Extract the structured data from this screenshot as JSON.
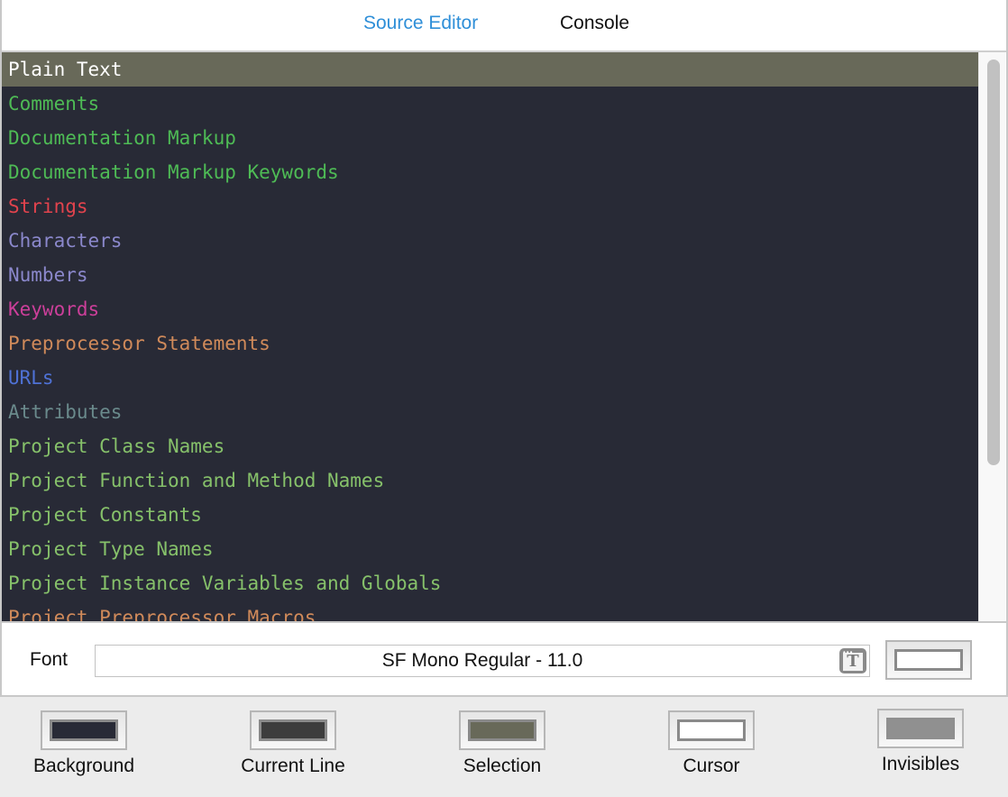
{
  "tabs": [
    {
      "label": "Source Editor",
      "active": true
    },
    {
      "label": "Console",
      "active": false
    }
  ],
  "syntax_items": [
    {
      "label": "Plain Text",
      "color": "#ffffff",
      "selected": true
    },
    {
      "label": "Comments",
      "color": "#4ebb55"
    },
    {
      "label": "Documentation Markup",
      "color": "#4ebb55"
    },
    {
      "label": "Documentation Markup Keywords",
      "color": "#4ebb55"
    },
    {
      "label": "Strings",
      "color": "#e2434d"
    },
    {
      "label": "Characters",
      "color": "#8b88cc"
    },
    {
      "label": "Numbers",
      "color": "#8b88cc"
    },
    {
      "label": "Keywords",
      "color": "#cc3f9a"
    },
    {
      "label": "Preprocessor Statements",
      "color": "#d08a5a"
    },
    {
      "label": "URLs",
      "color": "#4f72d6"
    },
    {
      "label": "Attributes",
      "color": "#6a8a8c"
    },
    {
      "label": "Project Class Names",
      "color": "#86c16a"
    },
    {
      "label": "Project Function and Method Names",
      "color": "#86c16a"
    },
    {
      "label": "Project Constants",
      "color": "#86c16a"
    },
    {
      "label": "Project Type Names",
      "color": "#86c16a"
    },
    {
      "label": "Project Instance Variables and Globals",
      "color": "#86c16a"
    },
    {
      "label": "Project Preprocessor Macros",
      "color": "#d08a5a"
    }
  ],
  "font": {
    "label": "Font",
    "value": "SF Mono Regular - 11.0",
    "picker_icon": "font-panel-icon",
    "color": "#ffffff"
  },
  "color_wells": [
    {
      "label": "Background",
      "color": "#282a36"
    },
    {
      "label": "Current Line",
      "color": "#3d3d3d"
    },
    {
      "label": "Selection",
      "color": "#686959"
    },
    {
      "label": "Cursor",
      "color": "#ffffff"
    },
    {
      "label": "Invisibles",
      "color": "#909090"
    }
  ]
}
